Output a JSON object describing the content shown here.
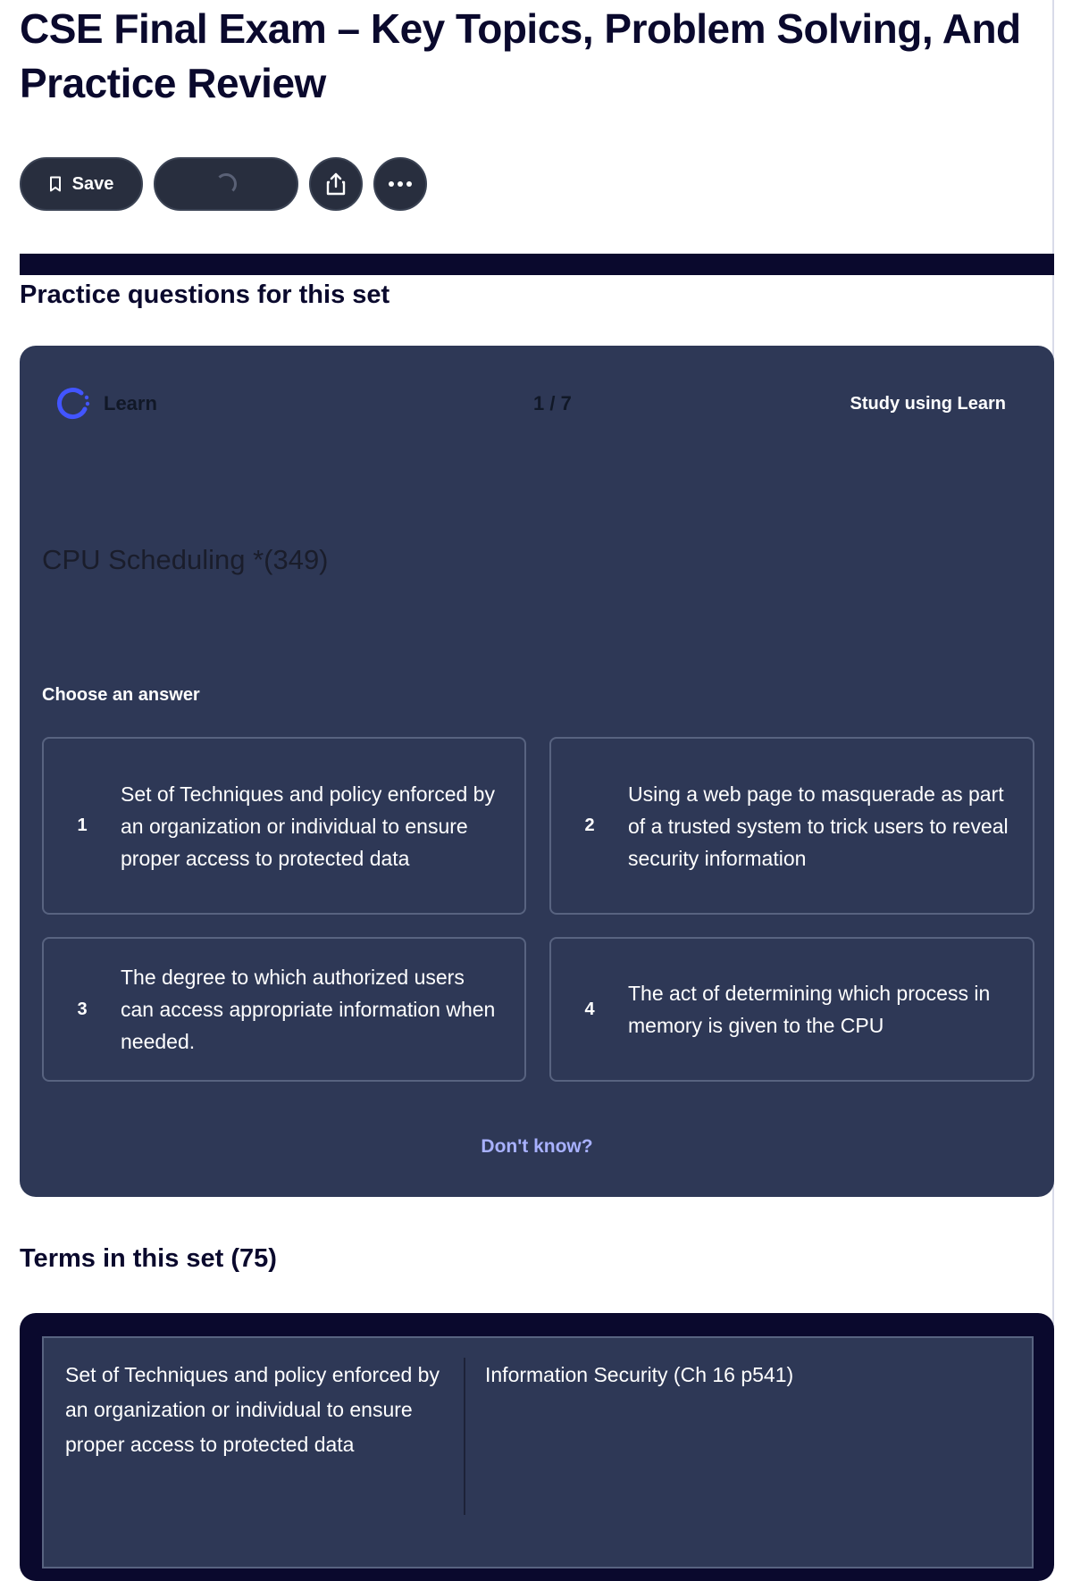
{
  "page": {
    "title": "CSE Final Exam – Key Topics, Problem Solving, And Practice Review"
  },
  "toolbar": {
    "save_label": "Save",
    "save_icon": "bookmark-icon",
    "share_icon": "share-icon",
    "more_icon": "more-icon"
  },
  "practice": {
    "heading": "Practice questions for this set",
    "learn_label": "Learn",
    "progress": "1 / 7",
    "study_link": "Study using Learn",
    "question": "CPU Scheduling *(349)",
    "choose_label": "Choose an answer",
    "answers": [
      {
        "number": "1",
        "text": "Set of Techniques and policy enforced by an organization or individual to ensure proper access to protected data"
      },
      {
        "number": "2",
        "text": "Using a web page to masquerade as part of a trusted system to trick users to reveal security information"
      },
      {
        "number": "3",
        "text": "The degree to which authorized users can access appropriate information when needed."
      },
      {
        "number": "4",
        "text": "The act of determining which process in memory is given to the CPU"
      }
    ],
    "dont_know": "Don't know?"
  },
  "terms": {
    "heading": "Terms in this set (75)",
    "items": [
      {
        "definition": "Set of Techniques and policy enforced by an organization or individual to ensure proper access to protected data",
        "term": "Information Security (Ch 16 p541)"
      }
    ]
  },
  "colors": {
    "page_bg": "#ffffff",
    "text_dark": "#0a092d",
    "card_bg": "#2e3856",
    "card_border": "#586380",
    "accent_link": "#a8b1ff",
    "learn_icon": "#4255ff"
  }
}
